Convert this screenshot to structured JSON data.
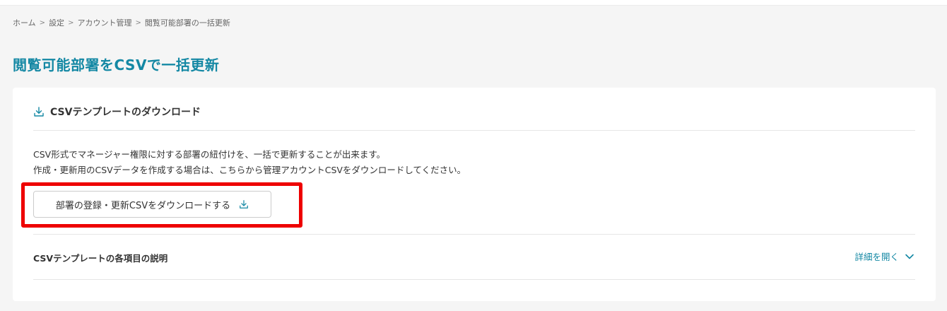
{
  "breadcrumb": {
    "items": [
      "ホーム",
      "設定",
      "アカウント管理",
      "閲覧可能部署の一括更新"
    ],
    "separator": ">"
  },
  "page": {
    "title": "閲覧可能部署をCSVで一括更新"
  },
  "template_section": {
    "heading": "CSVテンプレートのダウンロード",
    "heading_icon": "download-icon",
    "description_line1": "CSV形式でマネージャー権限に対する部署の紐付けを、一括で更新することが出来ます。",
    "description_line2": "作成・更新用のCSVデータを作成する場合は、こちらから管理アカウントCSVをダウンロードしてください。",
    "download_button_label": "部署の登録・更新CSVをダウンロードする",
    "download_button_icon": "download-icon"
  },
  "explanation_section": {
    "title": "CSVテンプレートの各項目の説明",
    "toggle_label": "詳細を開く",
    "toggle_icon": "chevron-down-icon"
  },
  "colors": {
    "accent": "#1488a4",
    "highlight": "#ee0000",
    "background": "#f5f5f5"
  }
}
